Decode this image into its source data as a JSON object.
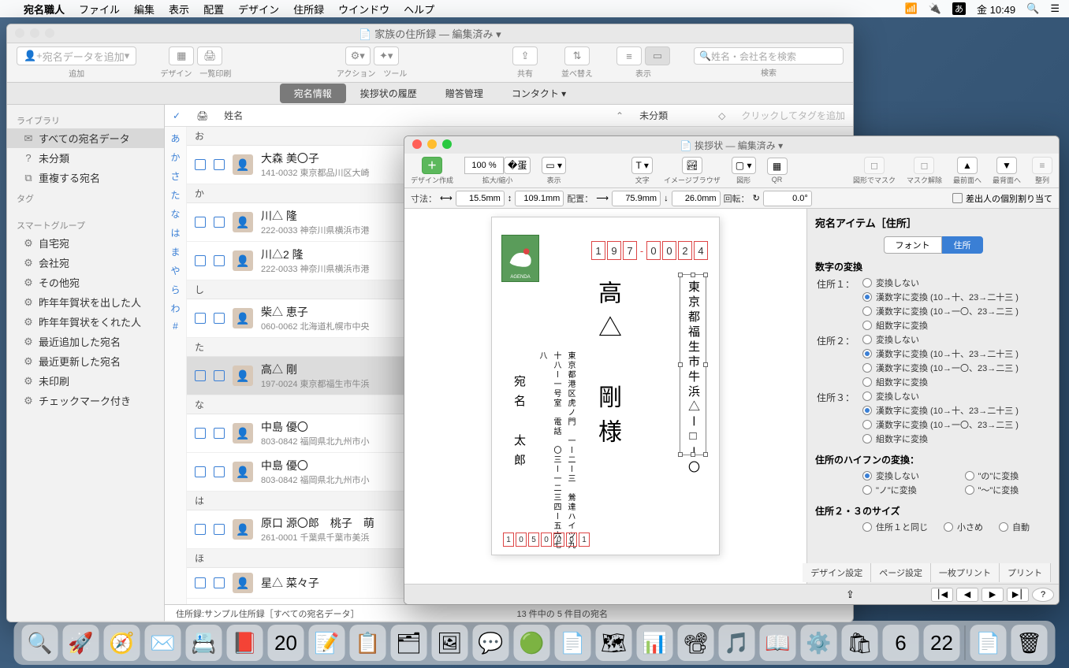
{
  "menubar": {
    "app": "宛名職人",
    "items": [
      "ファイル",
      "編集",
      "表示",
      "配置",
      "デザイン",
      "住所録",
      "ウインドウ",
      "ヘルプ"
    ],
    "clock": "金 10:49",
    "ime": "あ"
  },
  "main_window": {
    "title": "家族の住所録 — 編集済み",
    "toolbar": {
      "add_label": "宛名データを追加",
      "add_grp": "追加",
      "design": "デザイン",
      "print": "一覧印刷",
      "action": "アクション",
      "tool": "ツール",
      "share": "共有",
      "sort": "並べ替え",
      "view": "表示",
      "search_ph": "姓名・会社名を検索",
      "search_grp": "検索"
    },
    "tabs": [
      "宛名情報",
      "挨拶状の履歴",
      "贈答管理",
      "コンタクト"
    ],
    "sidebar": {
      "library": "ライブラリ",
      "lib_items": [
        {
          "ico": "✉",
          "txt": "すべての宛名データ",
          "sel": true
        },
        {
          "ico": "?",
          "txt": "未分類"
        },
        {
          "ico": "⧉",
          "txt": "重複する宛名"
        }
      ],
      "tags": "タグ",
      "smart": "スマートグループ",
      "smart_items": [
        "自宅宛",
        "会社宛",
        "その他宛",
        "昨年年賀状を出した人",
        "昨年年賀状をくれた人",
        "最近追加した宛名",
        "最近更新した宛名",
        "未印刷",
        "チェックマーク付き"
      ]
    },
    "list": {
      "col_name": "姓名",
      "col_tag": "未分類",
      "tag_ph": "クリックしてタグを追加",
      "kana": [
        "あ",
        "か",
        "さ",
        "た",
        "な",
        "は",
        "ま",
        "や",
        "ら",
        "わ",
        "#"
      ],
      "groups": [
        {
          "hdr": "お",
          "rows": [
            {
              "nm": "大森 美〇子",
              "addr": "141-0032 東京都品川区大崎"
            }
          ]
        },
        {
          "hdr": "か",
          "rows": [
            {
              "nm": "川△ 隆",
              "addr": "222-0033 神奈川県横浜市港"
            },
            {
              "nm": "川△2 隆",
              "addr": "222-0033 神奈川県横浜市港"
            }
          ]
        },
        {
          "hdr": "し",
          "rows": [
            {
              "nm": "柴△ 恵子",
              "addr": "060-0062 北海道札幌市中央"
            }
          ]
        },
        {
          "hdr": "た",
          "rows": [
            {
              "nm": "高△ 剛",
              "addr": "197-0024 東京都福生市牛浜",
              "sel": true
            }
          ]
        },
        {
          "hdr": "な",
          "rows": [
            {
              "nm": "中島 優〇",
              "addr": "803-0842 福岡県北九州市小"
            },
            {
              "nm": "中島 優〇",
              "addr": "803-0842 福岡県北九州市小"
            }
          ]
        },
        {
          "hdr": "は",
          "rows": [
            {
              "nm": "原口 源〇郎　桃子　萌",
              "addr": "261-0001 千葉県千葉市美浜"
            }
          ]
        },
        {
          "hdr": "ほ",
          "rows": [
            {
              "nm": "星△ 菜々子",
              "addr": ""
            }
          ]
        }
      ]
    },
    "status": {
      "left": "住所録:サンプル住所録［すべての宛名データ］",
      "right": "13 件中の 5 件目の宛名"
    }
  },
  "card_window": {
    "title": "挨拶状 — 編集済み",
    "toolbar": {
      "create": "デザイン作成",
      "zoom_val": "100 %",
      "zoom": "拡大/縮小",
      "view": "表示",
      "text": "文字",
      "img": "イメージブラウザ",
      "shape": "図形",
      "qr": "QR",
      "mask": "図形でマスク",
      "unmask": "マスク解除",
      "front": "最前面へ",
      "back": "最背面へ",
      "align": "整列"
    },
    "ruler": {
      "dim": "寸法：",
      "w": "15.5mm",
      "h": "109.1mm",
      "pos": "配置：",
      "x": "75.9mm",
      "y": "26.0mm",
      "rot": "回転：",
      "deg": "0.0°",
      "chk": "差出人の個別割り当て"
    },
    "postcard": {
      "zip_top": [
        "1",
        "9",
        "7",
        "-",
        "0",
        "0",
        "2",
        "4"
      ],
      "zip_btm": [
        "1",
        "0",
        "5",
        "0",
        "0",
        "0",
        "1"
      ],
      "addr": "東京都福生市牛浜△ー□ー〇",
      "name": "高△　剛様",
      "sender_addr_l1": "東京都港区虎ノ門",
      "sender_addr_l2": "一ー二ー三　鶯達ハイツ九十八ー一号室",
      "sender_addr_l3": "電話　〇三ー一二三四ー五六七八",
      "sender_name": "宛名　太郎"
    },
    "inspector": {
      "title": "宛名アイテム［住所］",
      "seg": [
        "フォント",
        "住所"
      ],
      "section1": "数字の変換",
      "addr_labels": [
        "住所１：",
        "住所２：",
        "住所３："
      ],
      "opts": [
        "変換しない",
        "漢数字に変換 (10→十、23→二十三 )",
        "漢数字に変換 (10→一〇、23→二三 )",
        "組数字に変換"
      ],
      "section2": "住所のハイフンの変換：",
      "hy_opts": [
        "変換しない",
        "\"の\"に変換",
        "\"ノ\"に変換",
        "\"〜\"に変換"
      ],
      "section3": "住所２・３のサイズ",
      "sz_opts": [
        "住所１と同じ",
        "小さめ",
        "自動"
      ]
    },
    "bottom_tabs": [
      "デザイン設定",
      "ページ設定",
      "一枚プリント",
      "プリント"
    ]
  },
  "dock": [
    "🔍",
    "🚀",
    "🧭",
    "✉️",
    "📇",
    "📕",
    "20",
    "📝",
    "📋",
    "🗂",
    "🖼",
    "💬",
    "🟢",
    "📄",
    "🗺",
    "📊",
    "📽",
    "🎵",
    "📖",
    "⚙️",
    "🛍",
    "6",
    "22",
    "",
    "📄",
    "🗑"
  ]
}
